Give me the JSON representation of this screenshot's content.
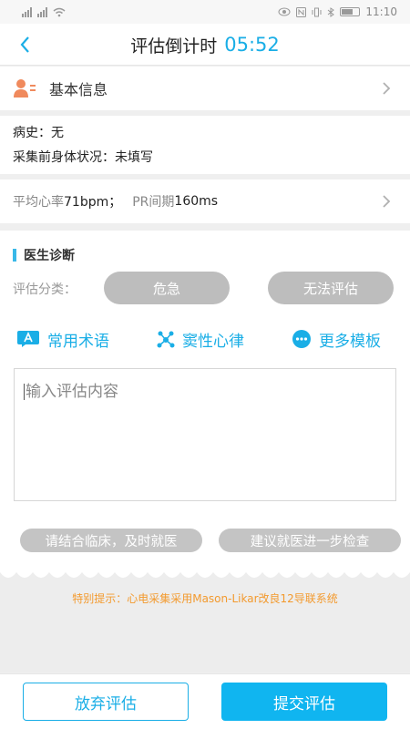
{
  "status": {
    "left_indicators": "HD 4G HD 4G",
    "time": "11:10"
  },
  "nav": {
    "title": "评估倒计时",
    "countdown": "05:52"
  },
  "basic_info": {
    "label": "基本信息"
  },
  "history": {
    "line1": "病史：无",
    "line2": "采集前身体状况：未填写"
  },
  "vitals": {
    "hr_label": "平均心率",
    "hr_value": "71bpm；",
    "pr_label": "PR间期",
    "pr_value": "160ms"
  },
  "diagnosis": {
    "title": "医生诊断",
    "category_label": "评估分类：",
    "categories": [
      "危急",
      "无法评估"
    ],
    "tools": [
      "常用术语",
      "窦性心律",
      "更多模板"
    ],
    "input_placeholder": "输入评估内容",
    "quick_phrases": [
      "请结合临床，及时就医",
      "建议就医进一步检查"
    ]
  },
  "tip": {
    "text": "特别提示：心电采集采用Mason-Likar改良12导联系统"
  },
  "actions": {
    "give_up": "放弃评估",
    "submit": "提交评估"
  },
  "colors": {
    "accent": "#1aaee6",
    "warning": "#f39a2e",
    "pill_gray": "#bdbdbd"
  }
}
